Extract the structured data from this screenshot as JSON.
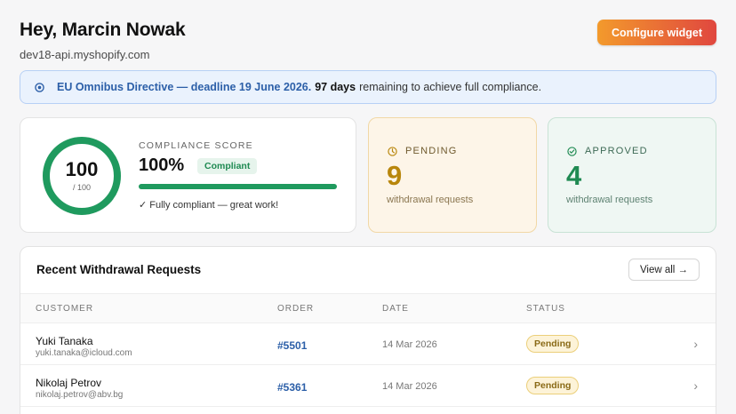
{
  "header": {
    "greeting": "Hey, Marcin Nowak",
    "domain": "dev18-api.myshopify.com",
    "configure_label": "Configure widget"
  },
  "banner": {
    "directive": "EU Omnibus Directive — deadline 19 June 2026.",
    "days": "97 days",
    "rest": "remaining to achieve full compliance."
  },
  "score": {
    "ring_value": "100",
    "ring_sub": "/ 100",
    "ring_fraction": 1.0,
    "label": "COMPLIANCE SCORE",
    "percent": "100%",
    "badge": "Compliant",
    "progress": 1.0,
    "note": "✓ Fully compliant — great work!"
  },
  "pending": {
    "label": "PENDING",
    "count": "9",
    "sub": "withdrawal requests"
  },
  "approved": {
    "label": "APPROVED",
    "count": "4",
    "sub": "withdrawal requests"
  },
  "table": {
    "title": "Recent Withdrawal Requests",
    "view_all": "View all →",
    "columns": [
      "CUSTOMER",
      "ORDER",
      "DATE",
      "STATUS"
    ],
    "rows": [
      {
        "name": "Yuki Tanaka",
        "email": "yuki.tanaka@icloud.com",
        "order": "#5501",
        "date": "14 Mar 2026",
        "status": "Pending"
      },
      {
        "name": "Nikolaj Petrov",
        "email": "nikolaj.petrov@abv.bg",
        "order": "#5361",
        "date": "14 Mar 2026",
        "status": "Pending"
      }
    ]
  },
  "colors": {
    "accent_blue": "#2c5fa8",
    "success": "#1f9a5e",
    "warning": "#b8860b",
    "button_gradient_start": "#f39a2c",
    "button_gradient_end": "#e0473f"
  },
  "icons": {
    "banner": "target-icon",
    "pending": "clock-icon",
    "approved": "check-circle-icon",
    "row_action": "chevron-right-icon"
  }
}
